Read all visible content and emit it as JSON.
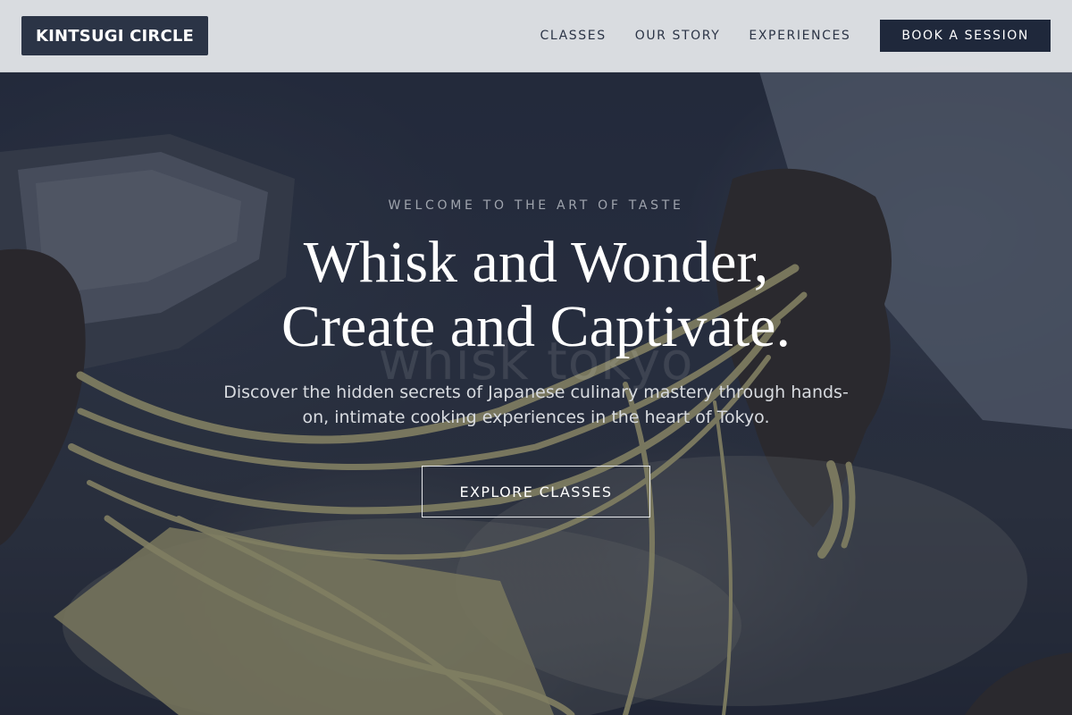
{
  "header": {
    "logo": "KINTSUGI CIRCLE",
    "nav": [
      {
        "label": "CLASSES"
      },
      {
        "label": "OUR STORY"
      },
      {
        "label": "EXPERIENCES"
      }
    ],
    "cta_label": "BOOK A SESSION"
  },
  "hero": {
    "eyebrow": "WELCOME TO THE ART OF TASTE",
    "headline_line1": "Whisk and Wonder,",
    "headline_line2": "Create and Captivate.",
    "watermark": "whisk tokyo",
    "subtitle": "Discover the hidden secrets of Japanese culinary mastery through hands-on, intimate cooking experiences in the heart of Tokyo.",
    "button_label": "EXPLORE CLASSES"
  },
  "colors": {
    "brand_dark": "#2b3446",
    "header_bg": "#e4e6e9",
    "overlay": "#161c2e"
  },
  "icons": {
    "hero_image": "pasta-making-photo"
  }
}
